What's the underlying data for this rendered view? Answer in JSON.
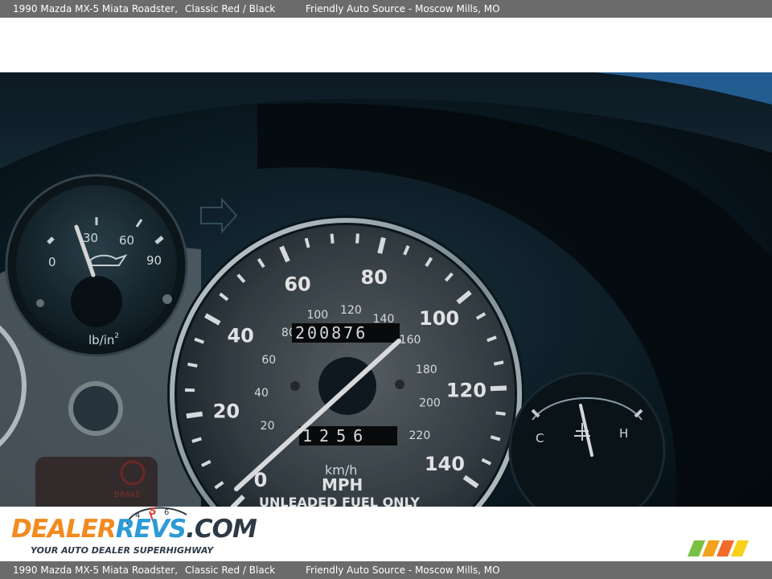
{
  "header": {
    "car": "1990 Mazda MX-5 Miata Roadster,",
    "color": "Classic Red / Black",
    "dealer": "Friendly Auto Source - Moscow Mills, MO"
  },
  "footer_bar": {
    "car": "1990 Mazda MX-5 Miata Roadster,",
    "color": "Classic Red / Black",
    "dealer": "Friendly Auto Source - Moscow Mills, MO"
  },
  "logo": {
    "dealer": "DEALER",
    "revs": "REVS",
    "com": ".COM",
    "tagline": "YOUR AUTO DEALER SUPERHIGHWAY",
    "gauge_digits": [
      "4",
      "5",
      "6"
    ]
  },
  "photo": {
    "odometer": "200876",
    "tripmeter": "1256",
    "mph_labels": [
      "0",
      "20",
      "40",
      "60",
      "80",
      "100",
      "120",
      "140"
    ],
    "kmh_labels": [
      "20",
      "40",
      "60",
      "80",
      "100",
      "120",
      "140",
      "160",
      "180",
      "200",
      "220"
    ],
    "unit_kmh": "km/h",
    "unit_mph": "MPH",
    "fuel_note": "UNLEADED FUEL ONLY",
    "oil_labels": [
      "0",
      "30",
      "60",
      "90"
    ],
    "oil_unit": "lb/in",
    "oil_unit_sup": "2",
    "temp_cold": "C",
    "temp_hot": "H",
    "brake_label": "BRAKE"
  }
}
